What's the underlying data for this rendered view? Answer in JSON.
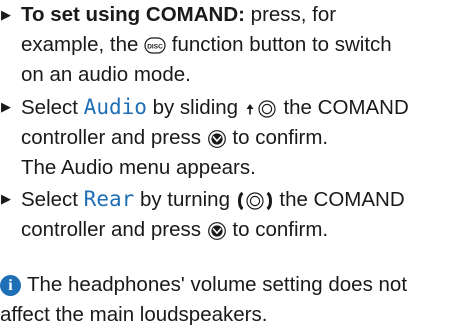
{
  "steps": [
    {
      "lead_bold": "To set using COMAND:",
      "l1_rest": " press, for",
      "l2_pre": "example, the ",
      "l2_post": " function button to switch",
      "l3": "on an audio mode."
    },
    {
      "l1_pre": "Select ",
      "l1_hl": "Audio",
      "l1_mid": " by sliding ",
      "l1_post": " the COMAND",
      "l2_pre": "controller and press ",
      "l2_post": " to confirm.",
      "l3": "The Audio menu appears."
    },
    {
      "l1_pre": "Select ",
      "l1_hl": "Rear",
      "l1_mid": " by turning ",
      "l1_post": " the COMAND",
      "l2_pre": "controller and press ",
      "l2_post": " to confirm."
    }
  ],
  "disc_button_label": "DISC",
  "info_glyph": "i",
  "note": {
    "line1": "The headphones' volume setting does not",
    "line2": "affect the main loudspeakers."
  },
  "colors": {
    "highlight": "#1e6fb6",
    "text": "#1a1a1a",
    "info_icon": "#1e6fb6"
  },
  "icons": [
    "bullet-arrow-icon",
    "disc-button-icon",
    "slide-up-controller-icon",
    "press-confirm-icon",
    "turn-controller-icon",
    "info-icon"
  ]
}
